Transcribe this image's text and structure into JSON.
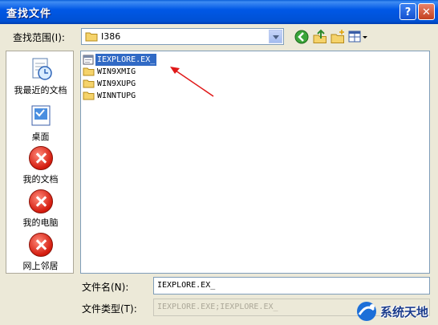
{
  "window": {
    "title": "查找文件",
    "help_label": "?",
    "close_label": "✕"
  },
  "lookin": {
    "label": "查找范围(I):",
    "value": "I386"
  },
  "toolbar": {
    "back_icon": "back-arrow-icon",
    "up_icon": "up-folder-icon",
    "newfolder_icon": "new-folder-icon",
    "view_icon": "view-menu-icon"
  },
  "places": [
    {
      "label": "我最近的文档",
      "icon": "recent-documents-icon"
    },
    {
      "label": "桌面",
      "icon": "desktop-icon"
    },
    {
      "label": "我的文档",
      "icon": "error-icon"
    },
    {
      "label": "我的电脑",
      "icon": "error-icon"
    },
    {
      "label": "网上邻居",
      "icon": "error-icon"
    }
  ],
  "files": [
    {
      "name": "IEXPLORE.EX_",
      "selected": true,
      "icon": "file-icon"
    },
    {
      "name": "WIN9XMIG",
      "selected": false,
      "icon": "folder-icon"
    },
    {
      "name": "WIN9XUPG",
      "selected": false,
      "icon": "folder-icon"
    },
    {
      "name": "WINNTUPG",
      "selected": false,
      "icon": "folder-icon"
    }
  ],
  "filename": {
    "label": "文件名(N):",
    "value": "IEXPLORE.EX_"
  },
  "filetype": {
    "label": "文件类型(T):",
    "value": "IEXPLORE.EXE;IEXPLORE.EX_"
  },
  "watermark": {
    "text": "系统天地"
  },
  "colors": {
    "titlebar": "#0058e6",
    "selection": "#316ac5",
    "arrow": "#e01818",
    "dialog_bg": "#ece9d8"
  }
}
